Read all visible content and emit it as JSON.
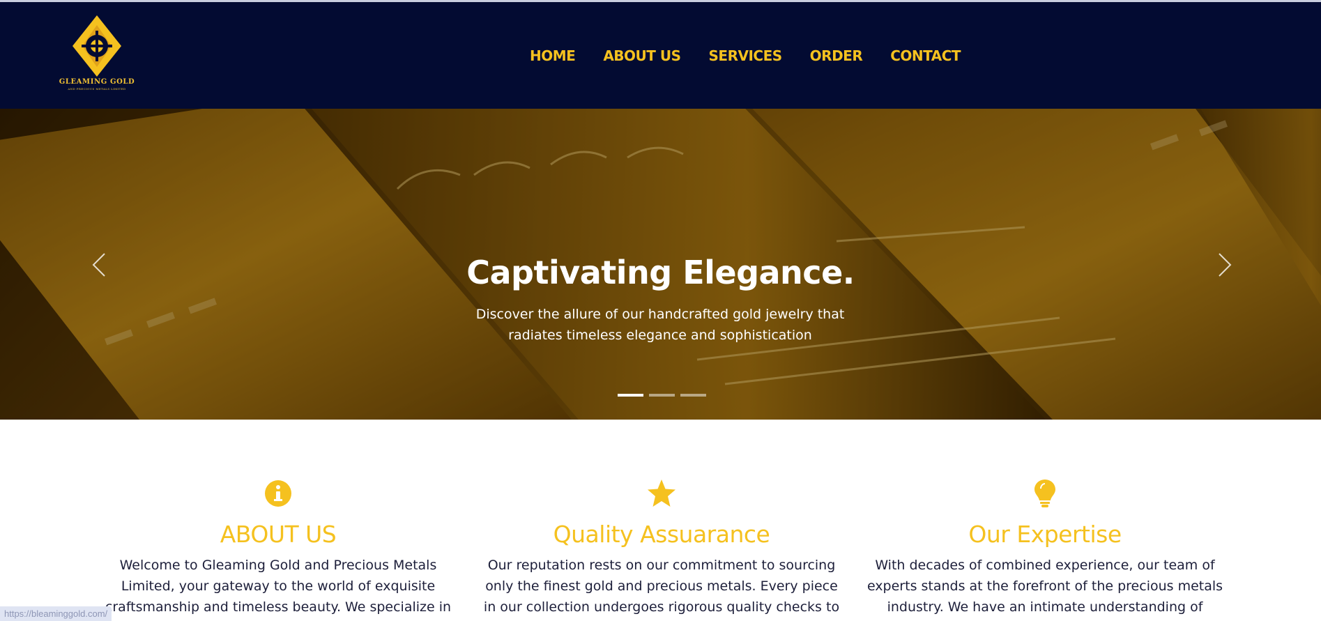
{
  "brand": {
    "name": "GLEAMING GOLD",
    "subtitle": "AND PRECIOUS METALS LIMITED",
    "gold": "#f5c11f",
    "navy": "#030b32"
  },
  "nav": {
    "items": [
      {
        "label": "HOME"
      },
      {
        "label": "ABOUT US"
      },
      {
        "label": "SERVICES"
      },
      {
        "label": "ORDER"
      },
      {
        "label": "CONTACT"
      }
    ]
  },
  "hero": {
    "title": "Captivating Elegance.",
    "text": "Discover the allure of our handcrafted gold jewelry that radiates timeless elegance and sophistication",
    "slides": 3,
    "active_slide": 1,
    "prev_icon": "chevron-left-icon",
    "next_icon": "chevron-right-icon"
  },
  "features": [
    {
      "icon": "info-circle-icon",
      "title": "ABOUT US",
      "text": "Welcome to Gleaming Gold and Precious Metals Limited, your gateway to the world of exquisite craftsmanship and timeless beauty. We specialize in offering a curated"
    },
    {
      "icon": "star-icon",
      "title": "Quality Assuarance",
      "text": "Our reputation rests on our commitment to sourcing only the finest gold and precious metals. Every piece in our collection undergoes rigorous quality checks to ensure"
    },
    {
      "icon": "lightbulb-icon",
      "title": "Our Expertise",
      "text": "With decades of combined experience, our team of experts stands at the forefront of the precious metals industry. We have an intimate understanding of market"
    }
  ],
  "status_url": "https://bleaminggold.com/"
}
